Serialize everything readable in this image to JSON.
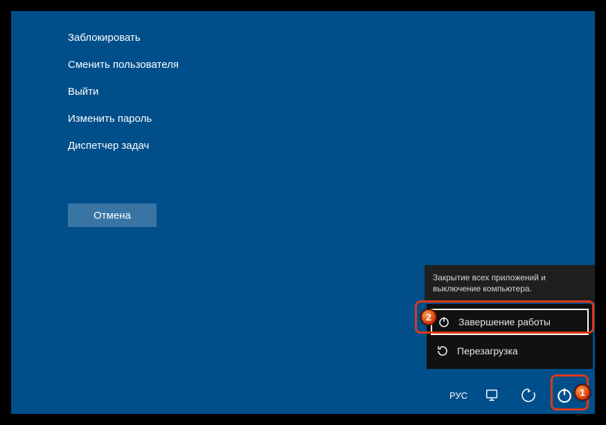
{
  "menu": {
    "items": [
      "Заблокировать",
      "Сменить пользователя",
      "Выйти",
      "Изменить пароль",
      "Диспетчер задач"
    ],
    "cancel": "Отмена"
  },
  "tooltip": {
    "text": "Закрытие всех приложений и выключение компьютера."
  },
  "power_menu": {
    "shutdown": "Завершение работы",
    "restart": "Перезагрузка"
  },
  "tray": {
    "language": "РУС"
  },
  "markers": {
    "one": "1",
    "two": "2"
  }
}
